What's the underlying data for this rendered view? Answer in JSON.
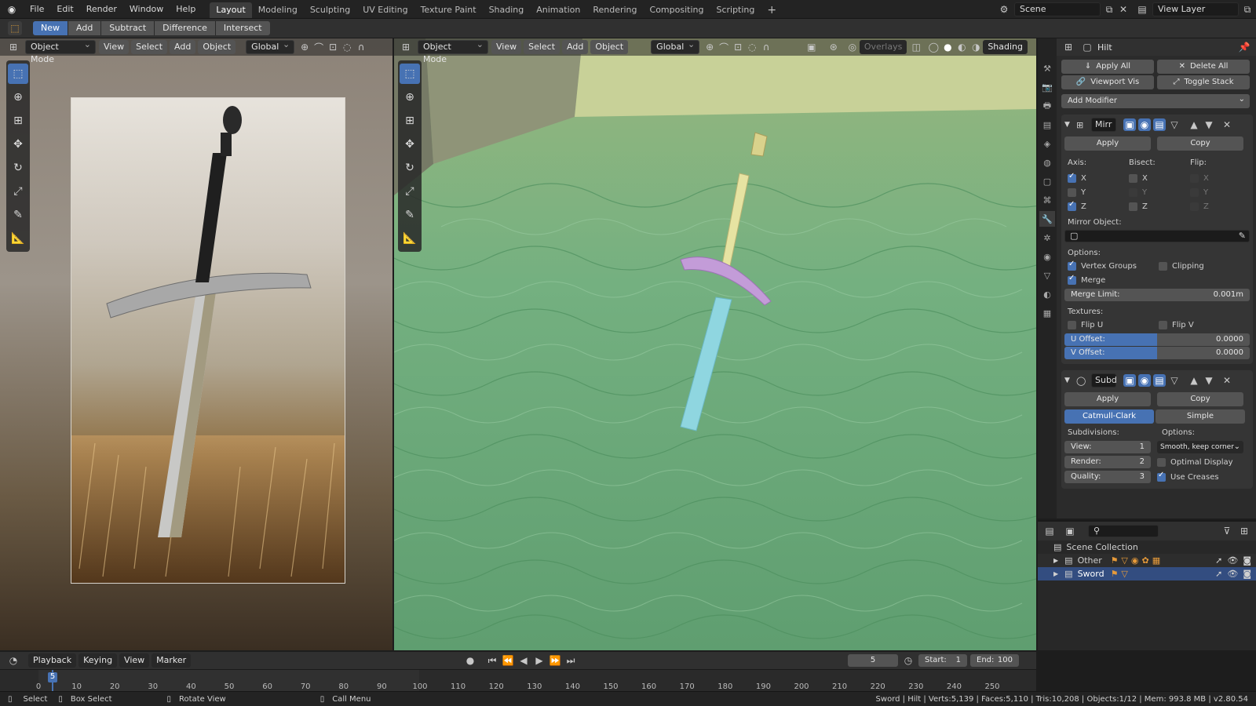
{
  "app": {
    "menu": [
      "File",
      "Edit",
      "Render",
      "Window",
      "Help"
    ],
    "workspaces": [
      "Layout",
      "Modeling",
      "Sculpting",
      "UV Editing",
      "Texture Paint",
      "Shading",
      "Animation",
      "Rendering",
      "Compositing",
      "Scripting"
    ],
    "active_workspace": "Layout",
    "add_workspace": "+",
    "scene": "Scene",
    "view_layer": "View Layer"
  },
  "tool_header": {
    "modes": [
      "New",
      "Add",
      "Subtract",
      "Difference",
      "Intersect"
    ],
    "active": "New"
  },
  "left_viewport": {
    "mode": "Object Mode",
    "menus": [
      "View",
      "Select",
      "Add",
      "Object"
    ],
    "transform": "Global"
  },
  "main_viewport": {
    "mode": "Object Mode",
    "menus": [
      "View",
      "Select",
      "Add",
      "Object"
    ],
    "transform": "Global",
    "overlays": "Overlays",
    "shading": "Shading"
  },
  "properties": {
    "object_name": "Hilt",
    "apply_all": "Apply All",
    "delete_all": "Delete All",
    "viewport_vis": "Viewport Vis",
    "toggle_stack": "Toggle Stack",
    "add_modifier": "Add Modifier",
    "mirror": {
      "name": "Mirr",
      "apply": "Apply",
      "copy": "Copy",
      "axis_label": "Axis:",
      "bisect_label": "Bisect:",
      "flip_label": "Flip:",
      "axes": [
        "X",
        "Y",
        "Z"
      ],
      "axis_checked": [
        true,
        false,
        true
      ],
      "mirror_object_label": "Mirror Object:",
      "options_label": "Options:",
      "vertex_groups": "Vertex Groups",
      "clipping": "Clipping",
      "merge": "Merge",
      "merge_limit_label": "Merge Limit:",
      "merge_limit_value": "0.001m",
      "textures_label": "Textures:",
      "flip_u": "Flip U",
      "flip_v": "Flip V",
      "u_offset_label": "U Offset:",
      "u_offset_value": "0.0000",
      "v_offset_label": "V Offset:",
      "v_offset_value": "0.0000"
    },
    "subsurf": {
      "name": "Subd",
      "apply": "Apply",
      "copy": "Copy",
      "catmull": "Catmull-Clark",
      "simple": "Simple",
      "subdivisions_label": "Subdivisions:",
      "options_label": "Options:",
      "view_label": "View:",
      "view_value": "1",
      "render_label": "Render:",
      "render_value": "2",
      "quality_label": "Quality:",
      "quality_value": "3",
      "uv_smooth": "Smooth, keep corners",
      "optimal_display": "Optimal Display",
      "use_creases": "Use Creases"
    }
  },
  "outliner": {
    "root": "Scene Collection",
    "items": [
      {
        "label": "Other",
        "selected": false
      },
      {
        "label": "Sword",
        "selected": true
      }
    ]
  },
  "timeline": {
    "menus": [
      "Playback",
      "Keying",
      "View",
      "Marker"
    ],
    "current_frame": "5",
    "start_label": "Start:",
    "start": "1",
    "end_label": "End:",
    "end": "100",
    "ticks": [
      "0",
      "10",
      "20",
      "30",
      "40",
      "50",
      "60",
      "70",
      "80",
      "90",
      "100",
      "110",
      "120",
      "130",
      "140",
      "150",
      "160",
      "170",
      "180",
      "190",
      "200",
      "210",
      "220",
      "230",
      "240",
      "250"
    ],
    "playhead_label": "5"
  },
  "statusbar": {
    "select": "Select",
    "box_select": "Box Select",
    "rotate_view": "Rotate View",
    "call_menu": "Call Menu",
    "stats": "Sword | Hilt | Verts:5,139 | Faces:5,110 | Tris:10,208 | Objects:1/12 | Mem: 993.8 MB | v2.80.54"
  }
}
